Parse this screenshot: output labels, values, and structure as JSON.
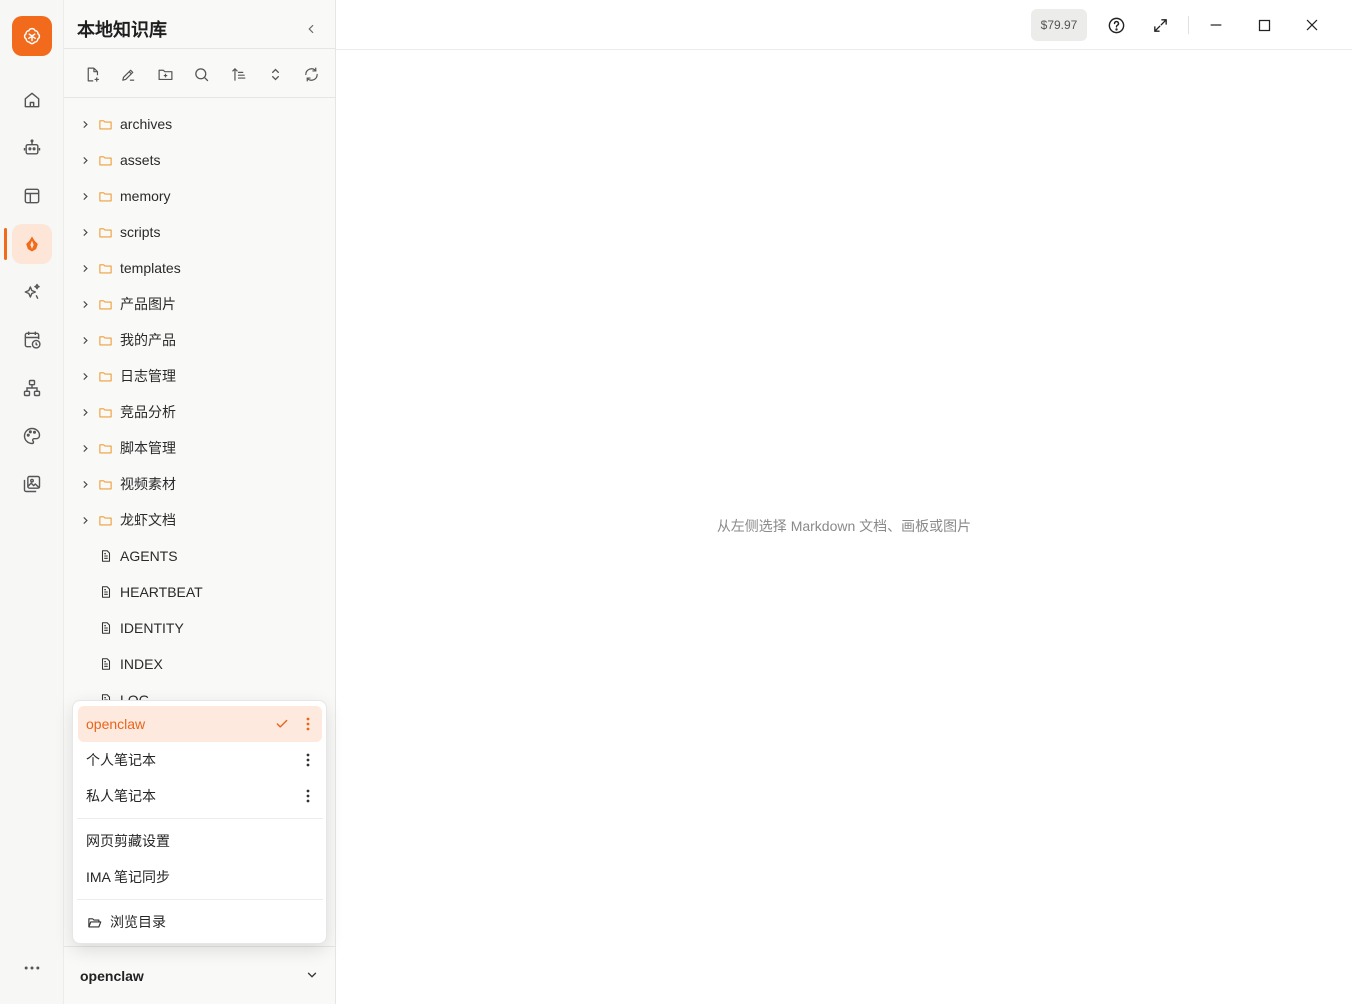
{
  "rail": {
    "logo_icon": "brain-logo-icon",
    "accent": "#f26a1b",
    "items": [
      {
        "icon": "home-icon"
      },
      {
        "icon": "robot-icon"
      },
      {
        "icon": "layout-panel-icon"
      },
      {
        "icon": "knowledge-base-icon",
        "active": true
      },
      {
        "icon": "sparkles-icon"
      },
      {
        "icon": "calendar-clock-icon"
      },
      {
        "icon": "org-chart-icon"
      },
      {
        "icon": "palette-icon"
      },
      {
        "icon": "gallery-icon"
      }
    ],
    "more_icon": "more-horizontal-icon"
  },
  "sidebar": {
    "title": "本地知识库",
    "toolbar": [
      "new-file-icon",
      "new-canvas-icon",
      "new-folder-icon",
      "search-icon",
      "sort-icon",
      "expand-collapse-icon",
      "refresh-icon"
    ],
    "tree": {
      "folders": [
        "archives",
        "assets",
        "memory",
        "scripts",
        "templates",
        "产品图片",
        "我的产品",
        "日志管理",
        "竞品分析",
        "脚本管理",
        "视频素材",
        "龙虾文档"
      ],
      "files": [
        "AGENTS",
        "HEARTBEAT",
        "IDENTITY",
        "INDEX",
        "LOG"
      ]
    },
    "workspace": {
      "current": "openclaw"
    }
  },
  "popup": {
    "notebooks": [
      {
        "label": "openclaw",
        "selected": true
      },
      {
        "label": "个人笔记本",
        "selected": false
      },
      {
        "label": "私人笔记本",
        "selected": false
      }
    ],
    "settings": [
      "网页剪藏设置",
      "IMA 笔记同步"
    ],
    "browse_label": "浏览目录"
  },
  "topbar": {
    "balance": "$79.97"
  },
  "main": {
    "empty_hint": "从左侧选择 Markdown 文档、画板或图片"
  }
}
